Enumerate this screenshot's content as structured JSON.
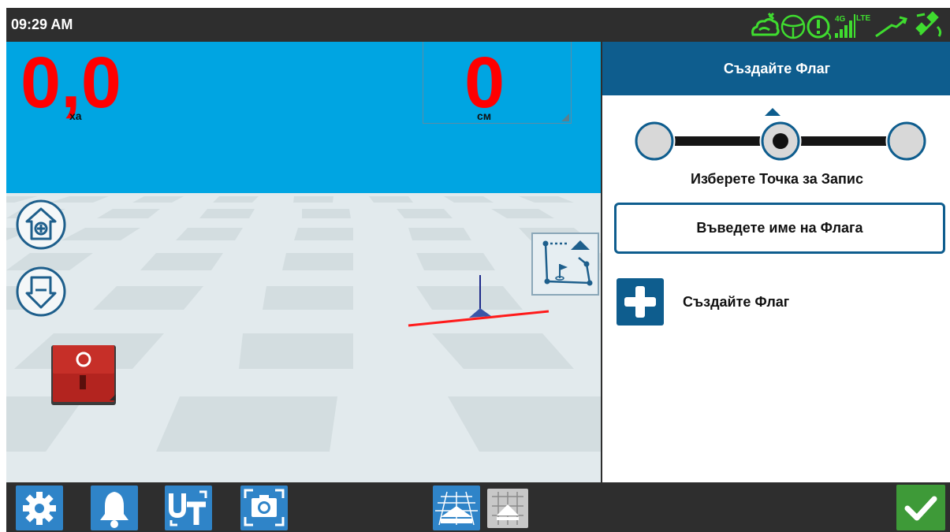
{
  "status_bar": {
    "time": "09:29 AM",
    "icons": [
      "cloud-sync-icon",
      "steering-wheel-icon",
      "alert-icon",
      "4g-lte-signal-icon",
      "correction-signal-icon",
      "satellite-icon"
    ],
    "network_label": "4G",
    "lte_label": "LTE",
    "icon_color": "#3fdc2f"
  },
  "map": {
    "area_value": "0,0",
    "area_unit": "ха",
    "crosstrack_value": "0",
    "crosstrack_unit": "см",
    "sky_color": "#00a5e2",
    "value_color": "#ff0000",
    "zoom_in_icon": "zoom-in-icon",
    "zoom_out_icon": "zoom-out-icon",
    "stop_icon": "power-switch-icon",
    "boundary_icon": "boundary-flag-icon"
  },
  "panel": {
    "title": "Създайте Флаг",
    "point_caption": "Изберете Точка за Запис",
    "selected_point": 2,
    "points_total": 3,
    "flag_name_placeholder": "Въведете име на Флага",
    "create_button_label": "Създайте Флаг",
    "accent_color": "#0e5d8e"
  },
  "toolbar": {
    "buttons": [
      "settings-icon",
      "bell-icon",
      "universal-terminal-icon",
      "camera-icon",
      "perspective-view-icon",
      "overhead-view-icon"
    ],
    "confirm_icon": "checkmark-icon",
    "button_color": "#2f84c8",
    "confirm_color": "#3e9a38"
  }
}
